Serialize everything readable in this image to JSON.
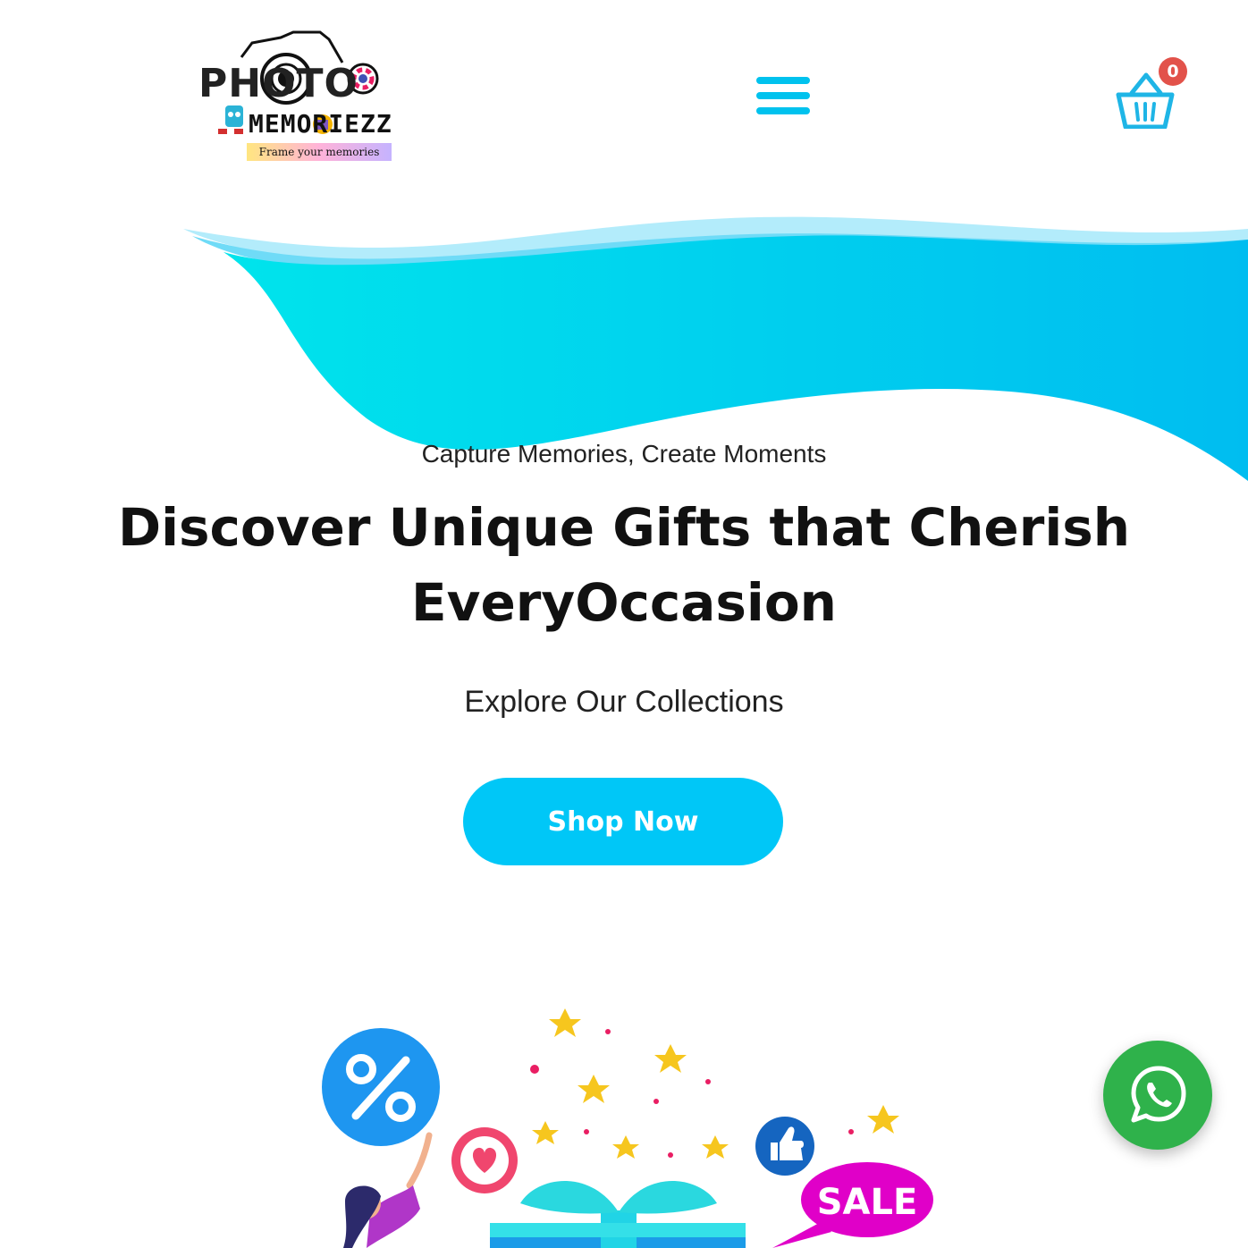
{
  "brand": {
    "logo_word_1": "PHOTO",
    "logo_word_2": "MEMORIEZZ",
    "logo_tagline": "Frame your memories"
  },
  "header": {
    "menu_icon": "hamburger-menu-icon",
    "cart_icon": "shopping-basket-icon",
    "cart_count": "0"
  },
  "hero": {
    "tagline": "Capture Memories, Create Moments",
    "headline": "Discover Unique Gifts that Cherish EveryOccasion",
    "subheading": "Explore Our Collections",
    "cta_label": "Shop Now"
  },
  "illustration": {
    "sale_label": "SALE"
  },
  "floating": {
    "whatsapp_icon": "whatsapp-icon"
  },
  "colors": {
    "accent": "#00c7f7",
    "badge": "#e2524a",
    "whatsapp": "#2fb24b"
  }
}
